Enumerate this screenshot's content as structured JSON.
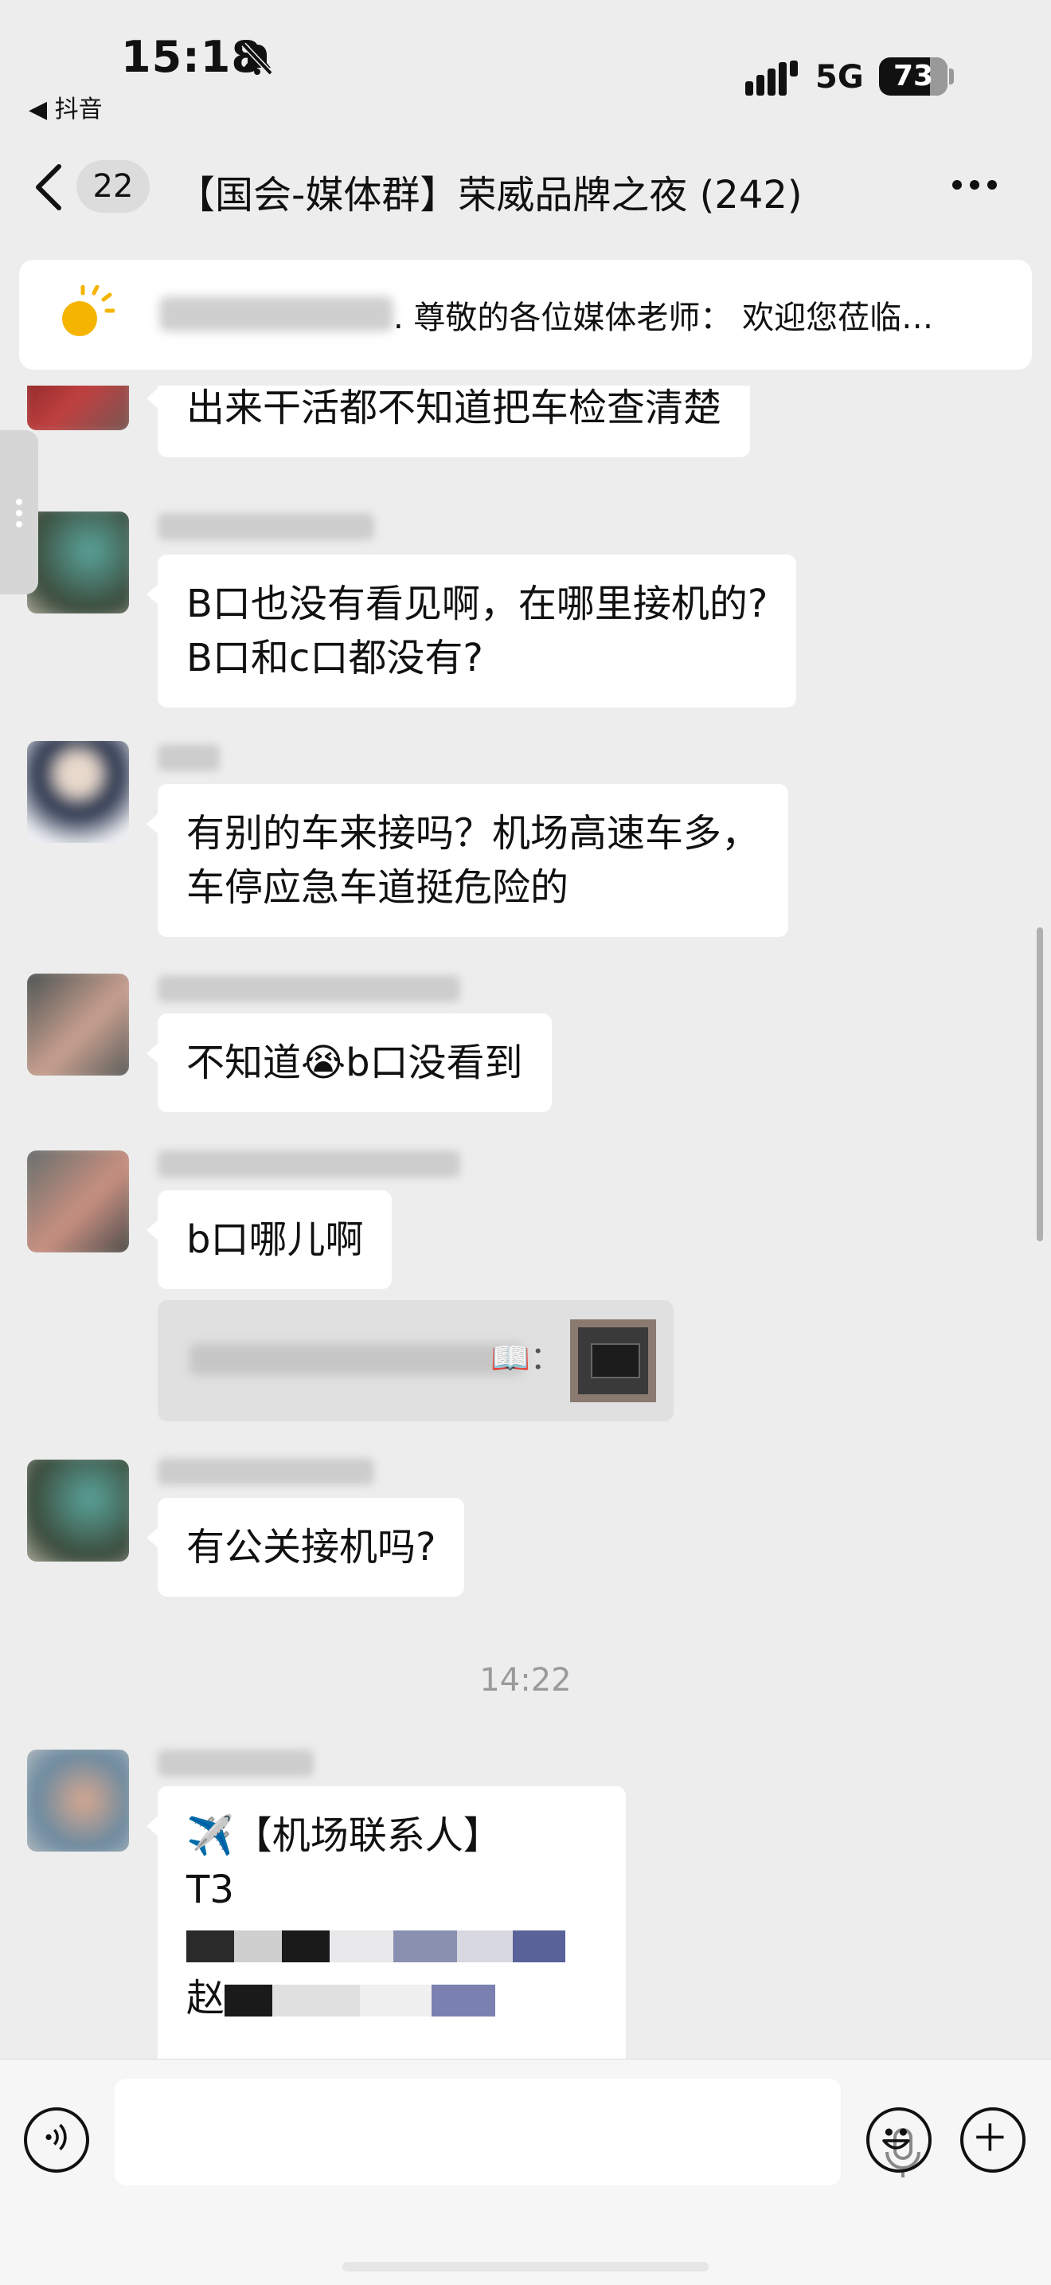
{
  "status_bar": {
    "time": "15:18",
    "back_app": "◀ 抖音",
    "network": "5G",
    "battery": "73",
    "battery_fraction": 0.73
  },
  "nav": {
    "unread_count": "22",
    "title": "【国会-媒体群】荣威品牌之夜 (242)"
  },
  "pinned": {
    "text": ". 尊敬的各位媒体老师： 欢迎您莅临…"
  },
  "messages": [
    {
      "lines": [
        "出来干活都不知道把车检查清楚"
      ]
    },
    {
      "lines": [
        "B口也没有看见啊，在哪里接机的?",
        "B口和c口都没有?"
      ]
    },
    {
      "lines": [
        "有别的车来接吗？机场高速车多，",
        "车停应急车道挺危险的"
      ]
    },
    {
      "lines": [
        "不知道😭b口没看到"
      ]
    },
    {
      "lines": [
        "b口哪儿啊"
      ],
      "quote_suffix": "📖："
    },
    {
      "lines": [
        "有公关接机吗?"
      ]
    },
    {
      "lines": [
        "✈️【机场联系人】",
        "T3",
        "",
        "赵"
      ]
    }
  ],
  "timestamp": "14:22",
  "colors": {
    "background": "#ededed",
    "bubble": "#ffffff",
    "input_bar": "#f6f6f6",
    "timestamp": "#9a9a9a"
  },
  "icons": [
    "bell-slash-icon",
    "signal-bars-icon",
    "battery-icon",
    "chevron-left-icon",
    "more-icon",
    "sun-icon",
    "voice-icon",
    "microphone-icon",
    "emoji-icon",
    "plus-icon"
  ]
}
